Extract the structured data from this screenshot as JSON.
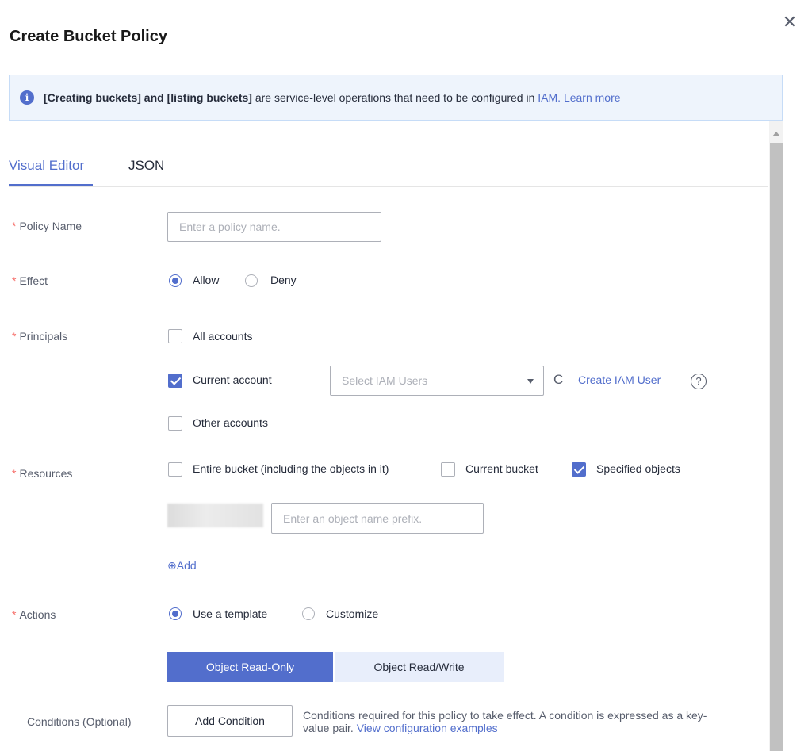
{
  "dialog": {
    "title": "Create Bucket Policy",
    "close_icon": "close-icon",
    "close_glyph": "✕"
  },
  "notice": {
    "icon": "info-icon",
    "icon_glyph": "i",
    "bold_text": "[Creating buckets] and [listing buckets]",
    "text": " are service-level operations that need to be configured in ",
    "iam_link": "IAM.",
    "learn_more": "Learn more"
  },
  "tabs": [
    {
      "label": "Visual Editor",
      "active": true
    },
    {
      "label": "JSON",
      "active": false
    }
  ],
  "form": {
    "required_mark": "*",
    "policy_name": {
      "label": "Policy Name",
      "placeholder": "Enter a policy name."
    },
    "effect": {
      "label": "Effect",
      "options": [
        "Allow",
        "Deny"
      ],
      "selected": "Allow"
    },
    "principals": {
      "label": "Principals",
      "all_accounts": {
        "label": "All accounts",
        "checked": false
      },
      "current_account": {
        "label": "Current account",
        "checked": true
      },
      "other_accounts": {
        "label": "Other accounts",
        "checked": false
      },
      "iam_select_placeholder": "Select IAM Users",
      "refresh_icon": "refresh-icon",
      "refresh_glyph": "C",
      "create_iam_user": "Create IAM User",
      "help_icon": "help-icon",
      "help_glyph": "?"
    },
    "resources": {
      "label": "Resources",
      "options": [
        {
          "label": "Entire bucket (including the objects in it)",
          "checked": false
        },
        {
          "label": "Current bucket",
          "checked": false
        },
        {
          "label": "Specified objects",
          "checked": true
        }
      ],
      "prefix_placeholder": "Enter an object name prefix.",
      "add_icon": "plus-circle-icon",
      "add_glyph": "⊕",
      "add_label": "Add"
    },
    "actions": {
      "label": "Actions",
      "options": [
        "Use a template",
        "Customize"
      ],
      "selected": "Use a template",
      "templates": [
        {
          "label": "Object Read-Only",
          "selected": true
        },
        {
          "label": "Object Read/Write",
          "selected": false
        }
      ]
    },
    "conditions": {
      "label": "Conditions (Optional)",
      "button": "Add Condition",
      "description": "Conditions required for this policy to take effect. A condition is expressed as a key-value pair.",
      "description_line1": "Conditions required for this policy to take effect. A condition is expressed as a key-",
      "description_line2": "value pair.",
      "link": "View configuration examples"
    }
  },
  "colors": {
    "accent": "#526ecc",
    "required": "#f66f6a",
    "notice_bg": "#eef4fc"
  }
}
